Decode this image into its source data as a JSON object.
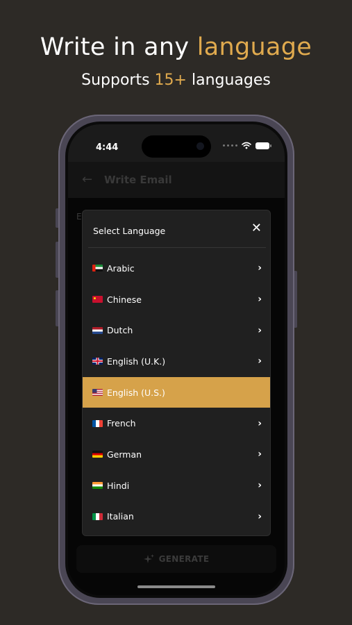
{
  "promo": {
    "headline_prefix": "Write in any ",
    "headline_accent": "language",
    "subhead_prefix": "Supports ",
    "subhead_accent": "15+",
    "subhead_suffix": " languages"
  },
  "status_bar": {
    "time": "4:44"
  },
  "app_bar": {
    "title": "Write Email",
    "back_icon": "arrow-left-icon"
  },
  "background": {
    "label_fragment": "E",
    "generate_label": "GENERATE",
    "generate_icon": "sparkles-icon"
  },
  "dialog": {
    "title": "Select Language",
    "close_label": "✕",
    "chevron": "›",
    "languages": [
      {
        "label": "Arabic",
        "flag": "ae"
      },
      {
        "label": "Chinese",
        "flag": "cn"
      },
      {
        "label": "Dutch",
        "flag": "nl"
      },
      {
        "label": "English (U.K.)",
        "flag": "gb"
      },
      {
        "label": "English (U.S.)",
        "flag": "us",
        "selected": true
      },
      {
        "label": "French",
        "flag": "fr"
      },
      {
        "label": "German",
        "flag": "de"
      },
      {
        "label": "Hindi",
        "flag": "in"
      },
      {
        "label": "Italian",
        "flag": "it"
      }
    ]
  },
  "colors": {
    "page_background": "#2d2a26",
    "accent": "#e0aa4e",
    "selected_row": "#d6a24a",
    "dialog_background": "#202020"
  }
}
